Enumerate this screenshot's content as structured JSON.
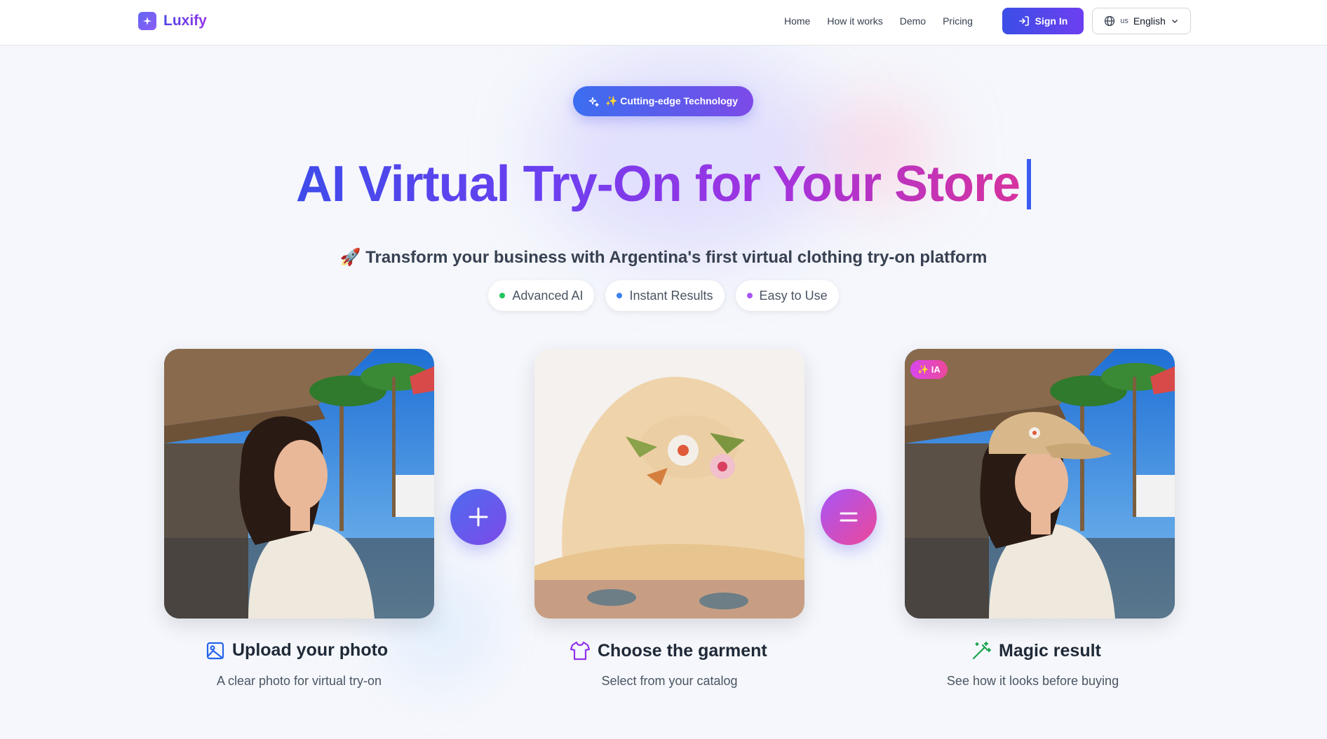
{
  "app": {
    "name": "Luxify"
  },
  "nav": {
    "links": [
      "Home",
      "How it works",
      "Demo",
      "Pricing"
    ],
    "sign_in": "Sign In",
    "language": {
      "code": "us",
      "label": "English"
    }
  },
  "hero": {
    "badge": "✨ Cutting-edge Technology",
    "title": "AI Virtual Try-On for Your Store",
    "subtitle": "🚀 Transform your business with Argentina's first virtual clothing try-on platform",
    "pills": [
      {
        "label": "Advanced AI",
        "color": "#22c55e"
      },
      {
        "label": "Instant Results",
        "color": "#3b82f6"
      },
      {
        "label": "Easy to Use",
        "color": "#a855f7"
      }
    ]
  },
  "steps": [
    {
      "title": "Upload your photo",
      "description": "A clear photo for virtual try-on",
      "icon": "image-icon",
      "icon_color": "#2563eb"
    },
    {
      "title": "Choose the garment",
      "description": "Select from your catalog",
      "icon": "shirt-icon",
      "icon_color": "#9333ea"
    },
    {
      "title": "Magic result",
      "description": "See how it looks before buying",
      "icon": "magic-wand-icon",
      "icon_color": "#16a34a",
      "badge": "✨ IA"
    }
  ],
  "operators": {
    "plus": "+",
    "equals": "="
  }
}
